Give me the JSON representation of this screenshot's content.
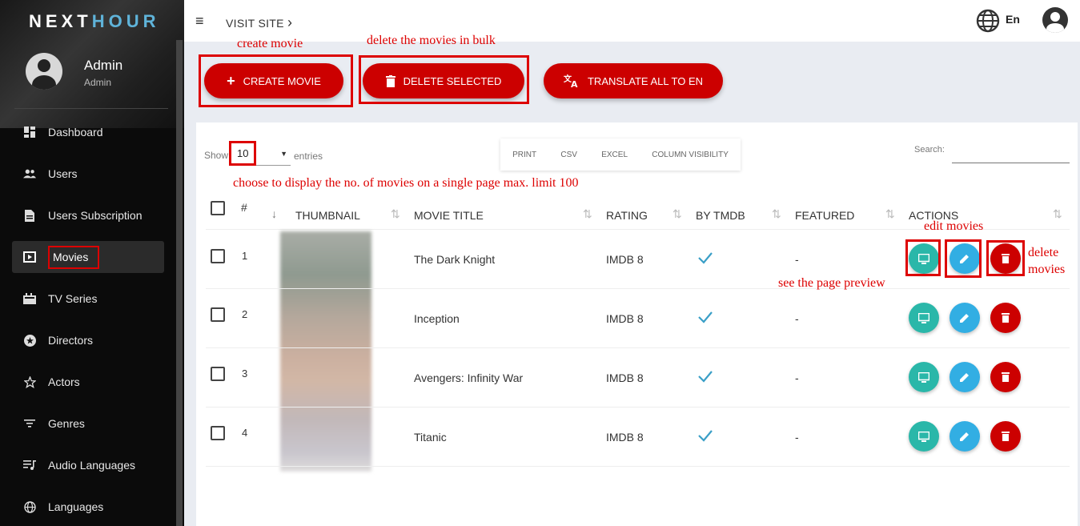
{
  "brand": {
    "logo_part1": "NEXT",
    "logo_part2": "HOUR"
  },
  "user": {
    "name": "Admin",
    "role": "Admin"
  },
  "sidebar": {
    "items": [
      {
        "label": "Dashboard",
        "icon": "dashboard-icon"
      },
      {
        "label": "Users",
        "icon": "users-icon"
      },
      {
        "label": "Users Subscription",
        "icon": "document-icon"
      },
      {
        "label": "Movies",
        "icon": "movie-icon"
      },
      {
        "label": "TV Series",
        "icon": "tv-series-icon"
      },
      {
        "label": "Directors",
        "icon": "star-circle-icon"
      },
      {
        "label": "Actors",
        "icon": "star-icon"
      },
      {
        "label": "Genres",
        "icon": "filter-icon"
      },
      {
        "label": "Audio Languages",
        "icon": "playlist-icon"
      },
      {
        "label": "Languages",
        "icon": "globe-icon"
      }
    ]
  },
  "topbar": {
    "visit_site": "VISIT SITE",
    "visit_site_chevron": "›",
    "lang": "En",
    "menu_glyph": "≡"
  },
  "actions": {
    "create": "CREATE MOVIE",
    "delete_selected": "DELETE SELECTED",
    "translate": "TRANSLATE ALL TO EN"
  },
  "annotations": {
    "create": "create movie",
    "bulk_delete": "delete the movies in bulk",
    "page_size": "choose to display the no. of movies on a single page max. limit 100",
    "edit": "edit movies",
    "delete_line1": "delete",
    "delete_line2": "movies",
    "preview": "see the page preview"
  },
  "table_controls": {
    "show": "Show",
    "page_size": "10",
    "entries": "entries",
    "export": [
      "PRINT",
      "CSV",
      "EXCEL",
      "COLUMN VISIBILITY"
    ],
    "search_label": "Search:"
  },
  "table": {
    "headers": [
      "#",
      "THUMBNAIL",
      "MOVIE TITLE",
      "RATING",
      "BY TMDB",
      "FEATURED",
      "ACTIONS"
    ],
    "rows": [
      {
        "num": "1",
        "title": "The Dark Knight",
        "rating": "IMDB 8",
        "featured": "-"
      },
      {
        "num": "2",
        "title": "Inception",
        "rating": "IMDB 8",
        "featured": "-"
      },
      {
        "num": "3",
        "title": "Avengers: Infinity War",
        "rating": "IMDB 8",
        "featured": "-"
      },
      {
        "num": "4",
        "title": "Titanic",
        "rating": "IMDB 8",
        "featured": "-"
      }
    ]
  },
  "colors": {
    "primary": "#cc0000",
    "preview": "#2ab7a9",
    "edit": "#32aee3",
    "tick": "#3a9fc7"
  }
}
